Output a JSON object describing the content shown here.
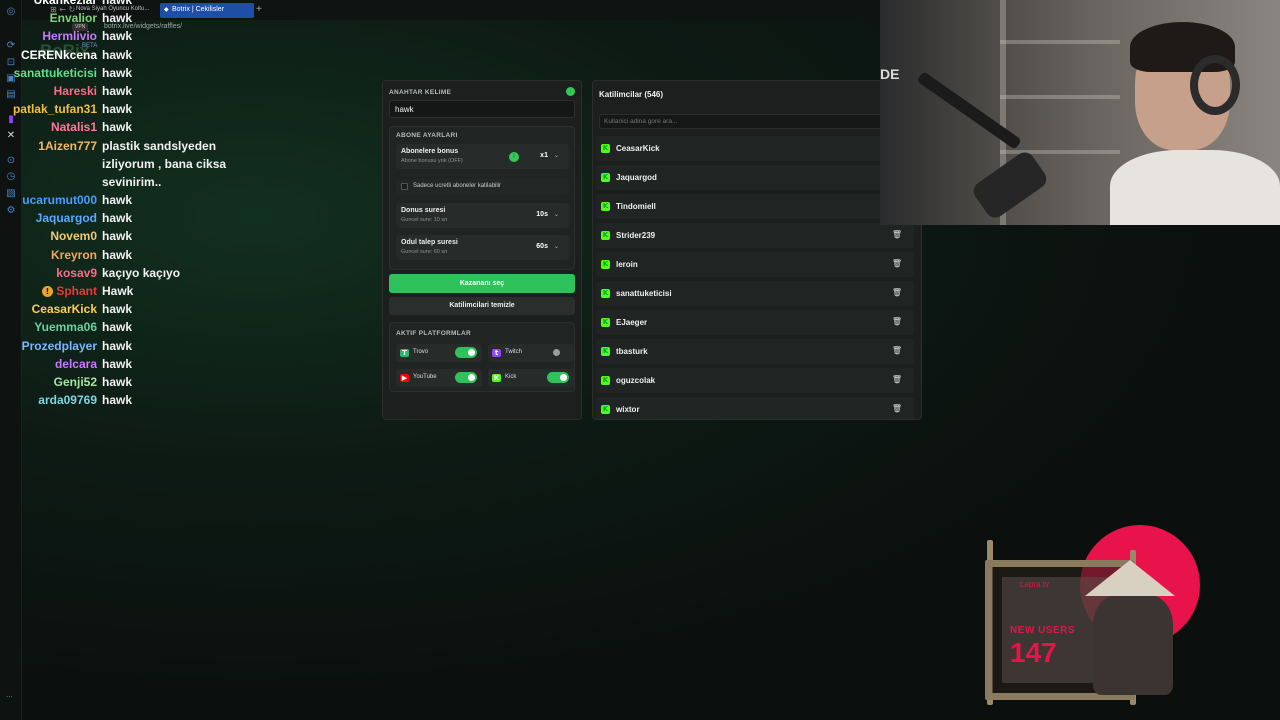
{
  "browser": {
    "tab_other": "Nova Siyah Oyuncu Koltu...",
    "tab_active": "Botrix | Cekilisler",
    "tab_plus": "+",
    "url": "botrix.live/widgets/raffles/",
    "url_badge": "VPN",
    "beta": "BETA",
    "brand": "BoRix",
    "nav_icons": "⊞  ←  ↻"
  },
  "chat": [
    {
      "user": "Ukankezlar",
      "msg": "hawk",
      "color": "#ffffff"
    },
    {
      "user": "Envalior",
      "msg": "hawk",
      "color": "#7cd67c"
    },
    {
      "user": "Hermlivio",
      "msg": "hawk",
      "color": "#c879ff"
    },
    {
      "user": "CERENkcena",
      "msg": "hawk",
      "color": "#ffffff"
    },
    {
      "user": "sanattuketicisi",
      "msg": "hawk",
      "color": "#5fe08a"
    },
    {
      "user": "Hareski",
      "msg": "hawk",
      "color": "#ff6b8a"
    },
    {
      "user": "patlak_tufan31",
      "msg": "hawk",
      "color": "#f0c040"
    },
    {
      "user": "Natalis1",
      "msg": "hawk",
      "color": "#ff7a9a"
    },
    {
      "user": "1Aizen777",
      "msg": "plastik sandslyeden",
      "color": "#f0b86a"
    },
    {
      "user": "",
      "msg": "izliyorum , bana ciksa",
      "color": "#ffffff"
    },
    {
      "user": "",
      "msg": "sevinirim..",
      "color": "#ffffff"
    },
    {
      "user": "ucarumut000",
      "msg": "hawk",
      "color": "#4a9cff"
    },
    {
      "user": "Jaquargod",
      "msg": "hawk",
      "color": "#5aa8ff"
    },
    {
      "user": "Novem0",
      "msg": "hawk",
      "color": "#f0c878"
    },
    {
      "user": "Kreyron",
      "msg": "hawk",
      "color": "#f0a860"
    },
    {
      "user": "kosav9",
      "msg": "kaçıyo kaçıyo",
      "color": "#ff6b8a"
    },
    {
      "user": "Sphant",
      "msg": "Hawk",
      "color": "#e83a3a"
    },
    {
      "user": "CeasarKick",
      "msg": "hawk",
      "color": "#ffcc55"
    },
    {
      "user": "Yuemma06",
      "msg": "hawk",
      "color": "#6ad0a0"
    },
    {
      "user": "Prozedplayer",
      "msg": "hawk",
      "color": "#7ab8ff"
    },
    {
      "user": "delcara",
      "msg": "hawk",
      "color": "#c879ff"
    },
    {
      "user": "Genji52",
      "msg": "hawk",
      "color": "#a8e6a0"
    },
    {
      "user": "arda09769",
      "msg": "hawk",
      "color": "#7cd6e0"
    }
  ],
  "settings": {
    "keyword_title": "ANAHTAR KELIME",
    "keyword_value": "hawk",
    "sub_title": "ABONE AYARLARI",
    "sub_bonus_name": "Abonelere bonus",
    "sub_bonus_sub": "Abone bonusu yok (OFF)",
    "sub_bonus_value": "x1",
    "sub_only_label": "Sadece ucretli aboneler katilabilir",
    "bonus_time_name": "Donus suresi",
    "bonus_time_sub": "Guncel sure: 10 sn",
    "bonus_time_value": "10s",
    "claim_time_name": "Odul talep suresi",
    "claim_time_sub": "Guncel sure: 60 sn",
    "claim_time_value": "60s",
    "pick_winner": "Kazananı seç",
    "clear_participants": "Katilimcilari temizle",
    "platforms_title": "AKTIF PLATFORMLAR",
    "platforms": [
      {
        "name": "Trovo",
        "on": true,
        "color": "#1fbf6a",
        "icon": "T"
      },
      {
        "name": "Twitch",
        "on": false,
        "color": "#9146ff",
        "icon": "t"
      },
      {
        "name": "YouTube",
        "on": true,
        "color": "#ff0000",
        "icon": "▶"
      },
      {
        "name": "Kick",
        "on": true,
        "color": "#53fc18",
        "icon": "K"
      }
    ]
  },
  "participants": {
    "title": "Katilimcilar (546)",
    "search_placeholder": "Kullanici adina gore ara...",
    "items": [
      "CeasarKick",
      "Jaquargod",
      "Tindomiell",
      "Strider239",
      "leroin",
      "sanattuketicisi",
      "EJaeger",
      "tbasturk",
      "oguzcolak",
      "wixtor"
    ]
  },
  "webcam": {
    "overlay_text": "DE"
  },
  "new_users": {
    "logo": "Lepra.tv",
    "label": "NEW USERS",
    "count": "147"
  },
  "colors": {
    "accent": "#2fc25b",
    "kick": "#53fc18",
    "widget": "#e7134a"
  }
}
